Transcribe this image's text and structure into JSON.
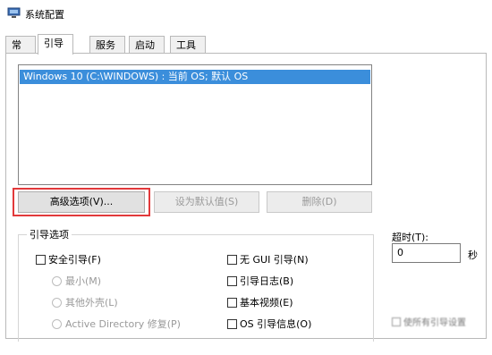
{
  "window": {
    "title": "系统配置"
  },
  "tabs": [
    {
      "label": "常规"
    },
    {
      "label": "引导"
    },
    {
      "label": "服务"
    },
    {
      "label": "启动"
    },
    {
      "label": "工具"
    }
  ],
  "boot_list": {
    "items": [
      {
        "label": "Windows 10 (C:\\WINDOWS) : 当前 OS; 默认 OS",
        "selected": true
      }
    ]
  },
  "buttons": {
    "advanced": "高级选项(V)...",
    "set_default": "设为默认值(S)",
    "delete": "删除(D)"
  },
  "boot_options": {
    "label": "引导选项",
    "safe_boot": "安全引导(F)",
    "minimal": "最小(M)",
    "alternate_shell": "其他外壳(L)",
    "active_directory": "Active Directory 修复(P)",
    "no_gui": "无 GUI 引导(N)",
    "boot_log": "引导日志(B)",
    "base_video": "基本视频(E)",
    "os_info": "OS 引导信息(O)"
  },
  "timeout": {
    "label": "超时(T):",
    "value": "0",
    "unit": "秒",
    "make_permanent": "使所有引导设置"
  },
  "colors": {
    "selection": "#3b8edb",
    "highlight_border": "#e2393b"
  }
}
